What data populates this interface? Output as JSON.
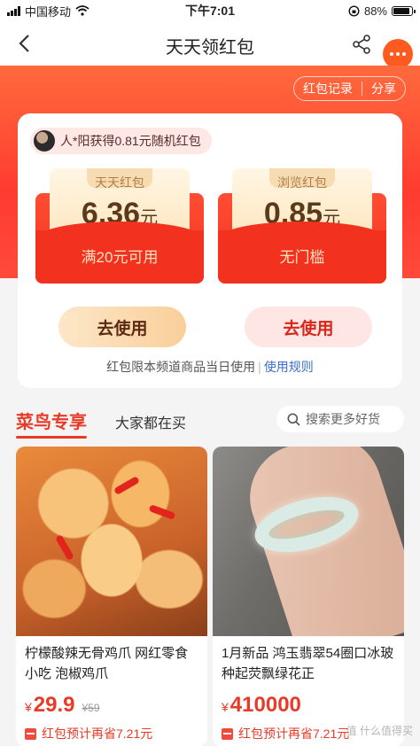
{
  "status_bar": {
    "carrier": "中国移动",
    "time": "下午7:01",
    "battery": "88%",
    "battery_level": 0.88
  },
  "nav": {
    "title": "天天领红包"
  },
  "hero": {
    "tab_record": "红包记录",
    "tab_share": "分享"
  },
  "card": {
    "winner_text": "人*阳获得0.81元随机红包",
    "envelopes": [
      {
        "label": "天天红包",
        "amount": "6.36",
        "unit": "元",
        "condition": "满20元可用",
        "button": "去使用"
      },
      {
        "label": "浏览红包",
        "amount": "0.85",
        "unit": "元",
        "condition": "无门槛",
        "button": "去使用"
      }
    ],
    "note": "红包限本频道商品当日使用",
    "note_sep": "|",
    "rules_link": "使用规则"
  },
  "section": {
    "tab_main": "菜鸟专享",
    "tab_sub": "大家都在买",
    "search_placeholder": "搜索更多好货"
  },
  "products": [
    {
      "title": "柠檬酸辣无骨鸡爪 网红零食小吃 泡椒鸡爪",
      "currency": "¥",
      "price": "29.9",
      "original_price": "¥59",
      "coupon": "红包预计再省7.21元"
    },
    {
      "title": "1月新品 鸿玉翡翠54圈口冰玻种起荧飘绿花正",
      "currency": "¥",
      "price": "410000",
      "original_price": "",
      "coupon": "红包预计再省7.21元"
    }
  ],
  "watermark": "值 什么值得买"
}
